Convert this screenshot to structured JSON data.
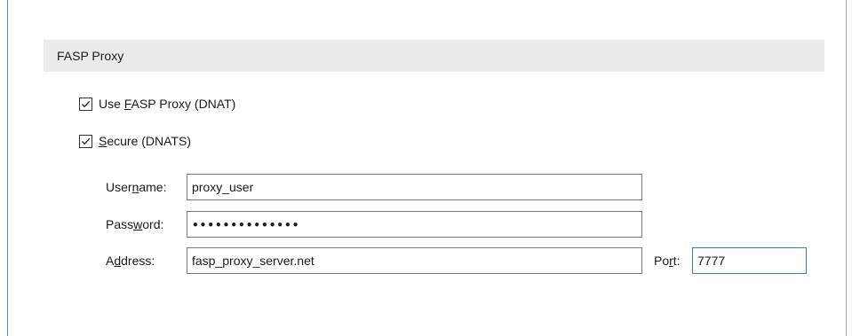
{
  "section": {
    "title": "FASP Proxy"
  },
  "use_proxy": {
    "label_pre": "Use ",
    "label_key": "F",
    "label_post": "ASP Proxy (DNAT)",
    "checked": true
  },
  "secure": {
    "label_pre": "",
    "label_key": "S",
    "label_post": "ecure (DNATS)",
    "checked": true
  },
  "username": {
    "label_pre": "User",
    "label_key": "n",
    "label_post": "ame:",
    "value": "proxy_user"
  },
  "password": {
    "label_pre": "Pass",
    "label_key": "w",
    "label_post": "ord:",
    "value": "••••••••••••••"
  },
  "address": {
    "label_pre": "A",
    "label_key": "d",
    "label_post": "dress:",
    "value": "fasp_proxy_server.net"
  },
  "port": {
    "label_pre": "Po",
    "label_key": "r",
    "label_post": "t:",
    "value": "7777"
  },
  "icons": {
    "checkmark": "checkmark-icon"
  }
}
